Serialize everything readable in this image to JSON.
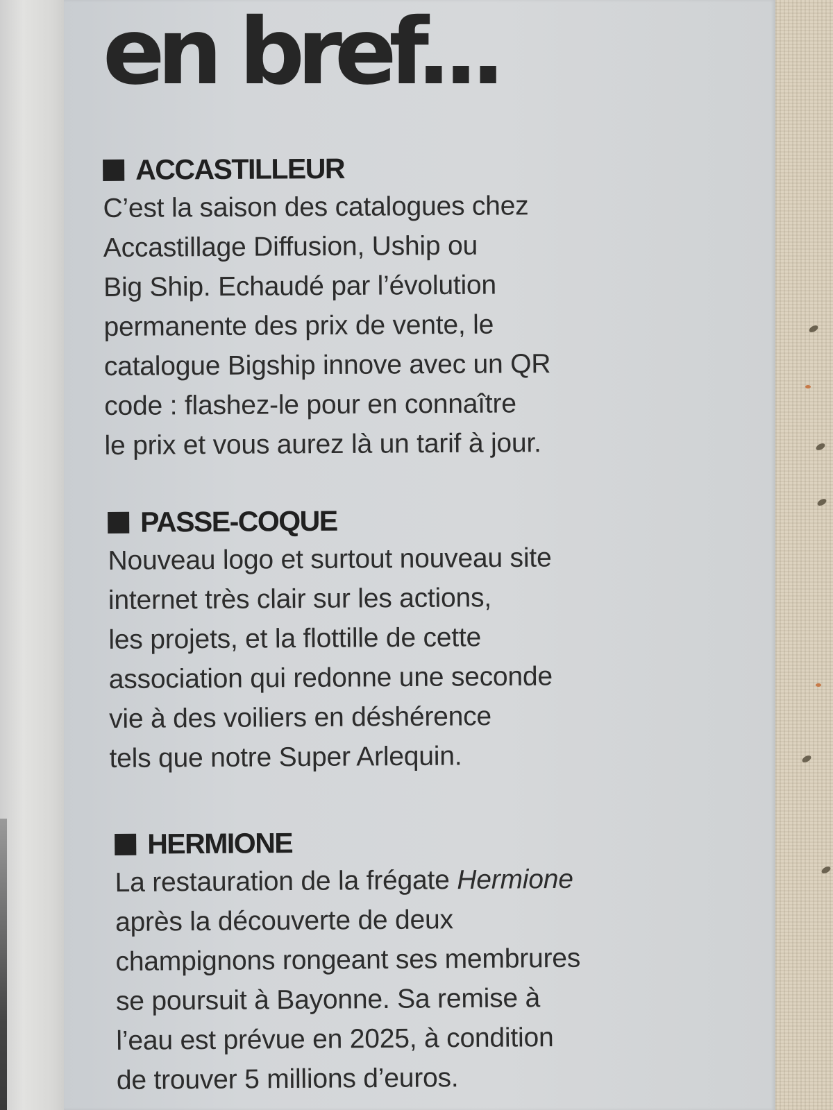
{
  "title": "en bref...",
  "sections": [
    {
      "heading": "ACCASTILLEUR",
      "lines": [
        "C’est la saison des catalogues chez",
        "Accastillage Diffusion, Uship ou",
        "Big Ship. Echaudé par l’évolution",
        "permanente des prix de vente, le",
        "catalogue Bigship innove avec un QR",
        "code : flashez-le pour en connaître",
        "le prix et vous aurez là un tarif à jour."
      ]
    },
    {
      "heading": "PASSE-COQUE",
      "lines": [
        "Nouveau logo et surtout nouveau site",
        "internet très clair sur les actions,",
        "les projets, et la flottille de cette",
        "association qui redonne une seconde",
        "vie à des voiliers en déshérence",
        "tels que notre Super Arlequin."
      ]
    },
    {
      "heading": "HERMIONE",
      "line1_prefix": "La restauration de la frégate ",
      "line1_italic": "Hermione",
      "lines": [
        "après la découverte de deux",
        "champignons rongeant ses membrures",
        "se poursuit à Bayonne. Sa remise à",
        "l’eau est prévue en 2025, à condition",
        "de trouver 5 millions d’euros."
      ]
    }
  ],
  "icons": {
    "bullet": "black-square-icon"
  },
  "colors": {
    "column_background": "#d4d7d9",
    "text": "#2c2c2c",
    "heading": "#202020"
  }
}
